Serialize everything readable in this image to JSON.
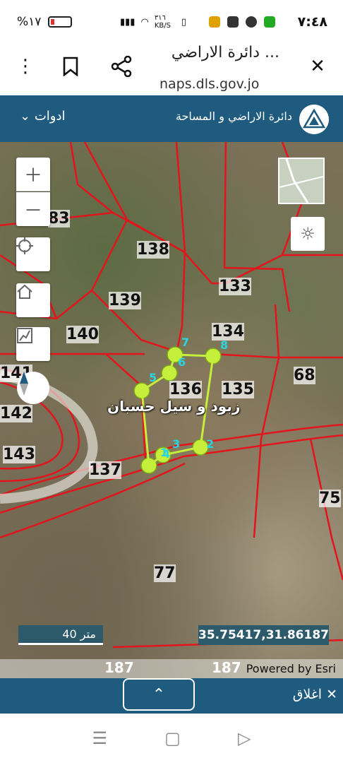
{
  "status": {
    "battery": "%١٧",
    "net_speed": "٣١٦ KB/S",
    "time": "٧:٤٨"
  },
  "browser": {
    "title": "دائرة الاراضي ...",
    "url": "naps.dls.gov.jo",
    "icons": [
      "menu-dots-icon",
      "bookmark-icon",
      "share-icon",
      "close-icon"
    ]
  },
  "app": {
    "name": "دائرة الاراضي و المساحة",
    "tools": "ادوات"
  },
  "map": {
    "parcels": [
      "83",
      "138",
      "133",
      "139",
      "134",
      "140",
      "68",
      "141",
      "136",
      "135",
      "142",
      "143",
      "137",
      "75",
      "77",
      "187",
      "187"
    ],
    "vertices": [
      "1",
      "2",
      "3",
      "4",
      "5",
      "6",
      "7",
      "8"
    ],
    "owner_label": "زبود و سيل حسبان",
    "scale": "40 متر",
    "coords": "35.75417,31.86187",
    "attribution": "Powered by Esri"
  },
  "bottom": {
    "close_label": "اغلاق"
  },
  "colors": {
    "header": "#1e5b7e",
    "parcel_line": "#e3141b",
    "selection": "#c6ef3c"
  }
}
